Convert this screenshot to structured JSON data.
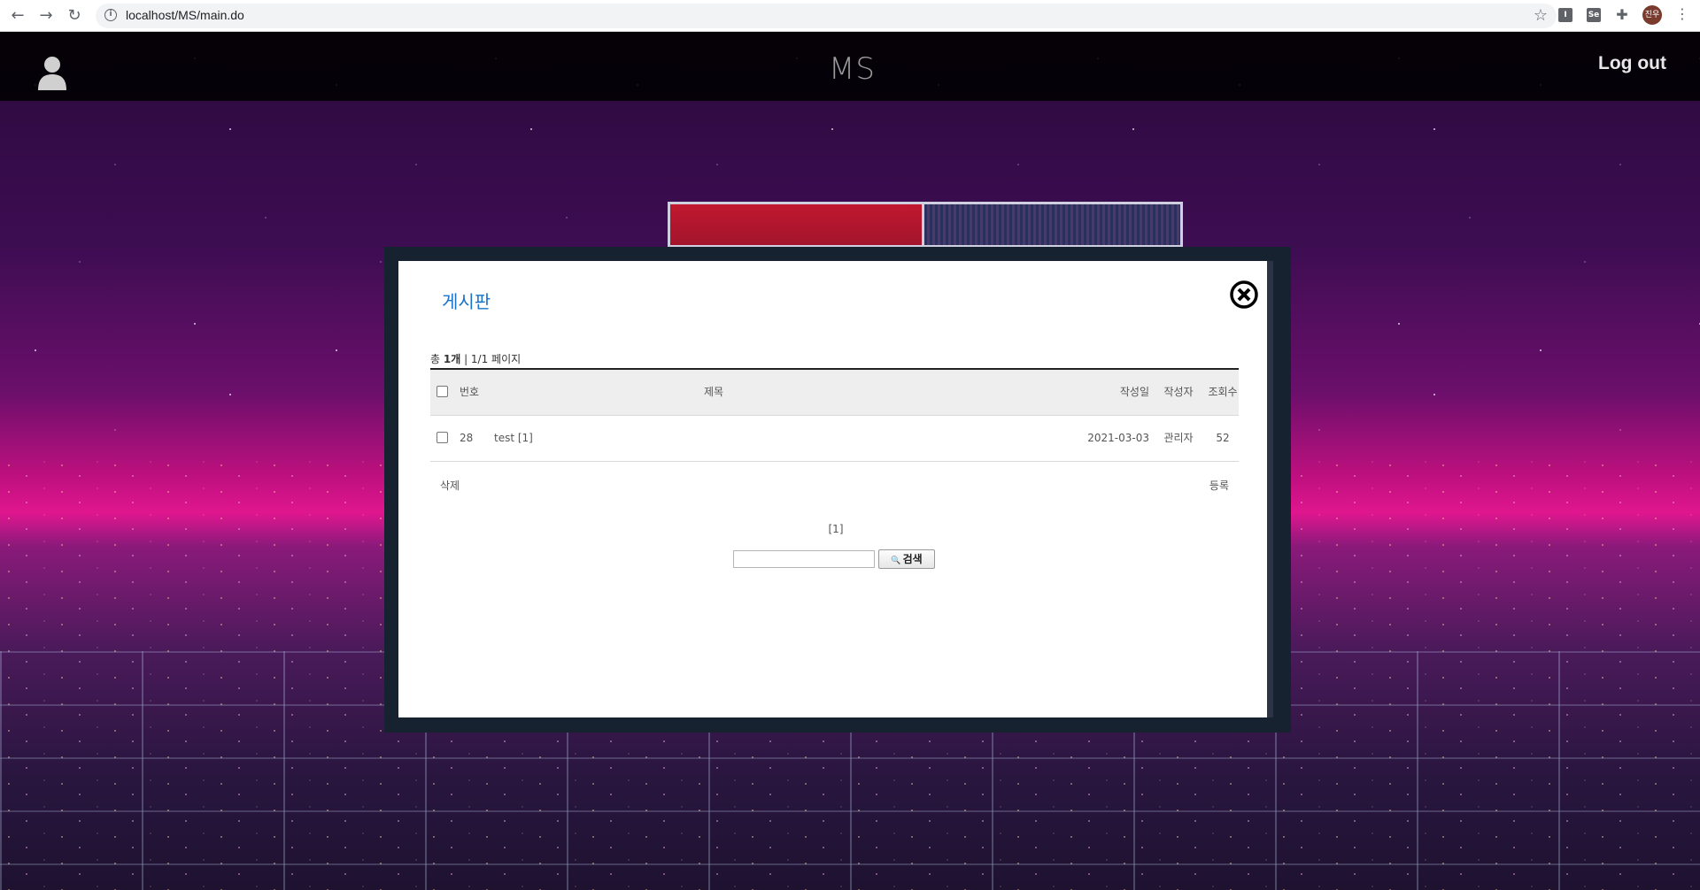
{
  "browser": {
    "url": "localhost/MS/main.do",
    "profile_initials": "진우",
    "ext1_label": "I",
    "ext2_label": "Se"
  },
  "site": {
    "logo": "MS",
    "logout_label": "Log out"
  },
  "modal": {
    "title": "게시판",
    "summary_prefix": "총 ",
    "summary_count": "1개",
    "summary_suffix": " | 1/1 페이지",
    "columns": {
      "no": "번호",
      "subject": "제목",
      "date": "작성일",
      "author": "작성자",
      "views": "조회수"
    },
    "rows": [
      {
        "no": "28",
        "subject": "test [1]",
        "date": "2021-03-03",
        "author": "관리자",
        "views": "52"
      }
    ],
    "delete_label": "삭제",
    "register_label": "등록",
    "pagination": "[1]",
    "search": {
      "value": "",
      "button_label": "검색"
    }
  }
}
